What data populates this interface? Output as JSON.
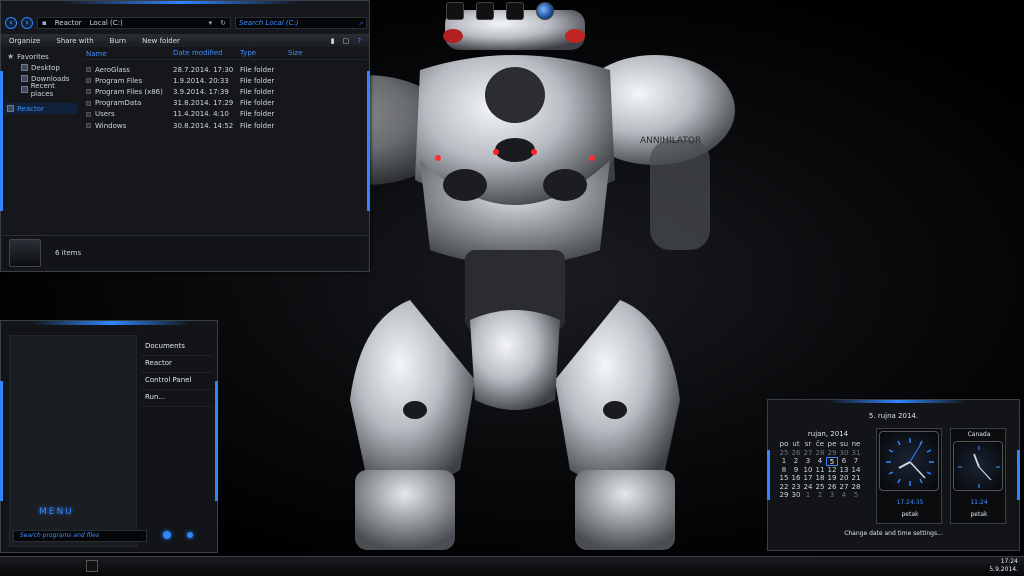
{
  "explorer": {
    "breadcrumb": [
      "Reactor",
      "Local (C:)"
    ],
    "search_placeholder": "Search Local (C:)",
    "toolbar": [
      "Organize",
      "Share with",
      "Burn",
      "New folder"
    ],
    "nav": {
      "favorites": "Favorites",
      "items": [
        "Desktop",
        "Downloads",
        "Recent places"
      ],
      "computer": "Reactor"
    },
    "columns": [
      "Name",
      "Date modified",
      "Type",
      "Size"
    ],
    "files": [
      {
        "name": "AeroGlass",
        "date": "28.7.2014. 17:30",
        "type": "File folder"
      },
      {
        "name": "Program Files",
        "date": "1.9.2014. 20:33",
        "type": "File folder"
      },
      {
        "name": "Program Files (x86)",
        "date": "3.9.2014. 17:39",
        "type": "File folder"
      },
      {
        "name": "ProgramData",
        "date": "31.8.2014. 17:29",
        "type": "File folder"
      },
      {
        "name": "Users",
        "date": "11.4.2014. 4:10",
        "type": "File folder"
      },
      {
        "name": "Windows",
        "date": "30.8.2014. 14:52",
        "type": "File folder"
      }
    ],
    "status": "6 items"
  },
  "startmenu": {
    "links": [
      "Documents",
      "Reactor",
      "Control Panel",
      "Run..."
    ],
    "menu_label": "MENU",
    "search_placeholder": "Search programs and files"
  },
  "clock_gadget": {
    "date": "5. rujna 2014.",
    "calendar": {
      "month": "rujan, 2014",
      "weekdays": [
        "po",
        "ut",
        "sr",
        "če",
        "pe",
        "su",
        "ne"
      ],
      "days": [
        "25",
        "26",
        "27",
        "28",
        "29",
        "30",
        "31",
        "1",
        "2",
        "3",
        "4",
        "5",
        "6",
        "7",
        "8",
        "9",
        "10",
        "11",
        "12",
        "13",
        "14",
        "15",
        "16",
        "17",
        "18",
        "19",
        "20",
        "21",
        "22",
        "23",
        "24",
        "25",
        "26",
        "27",
        "28",
        "29",
        "30",
        "1",
        "2",
        "3",
        "4",
        "5"
      ],
      "today": "5"
    },
    "clock_main": {
      "time": "17:24:35",
      "day": "petak"
    },
    "clock_second": {
      "label": "Canada",
      "time": "11:24",
      "day": "petak"
    },
    "change_link": "Change date and time settings..."
  },
  "taskbar": {
    "time": "17:24",
    "date": "5.9.2014."
  },
  "wallpaper": {
    "label": "ANNIHILATOR"
  },
  "colors": {
    "accent": "#2f86ff",
    "window_bg": "#15171b"
  }
}
